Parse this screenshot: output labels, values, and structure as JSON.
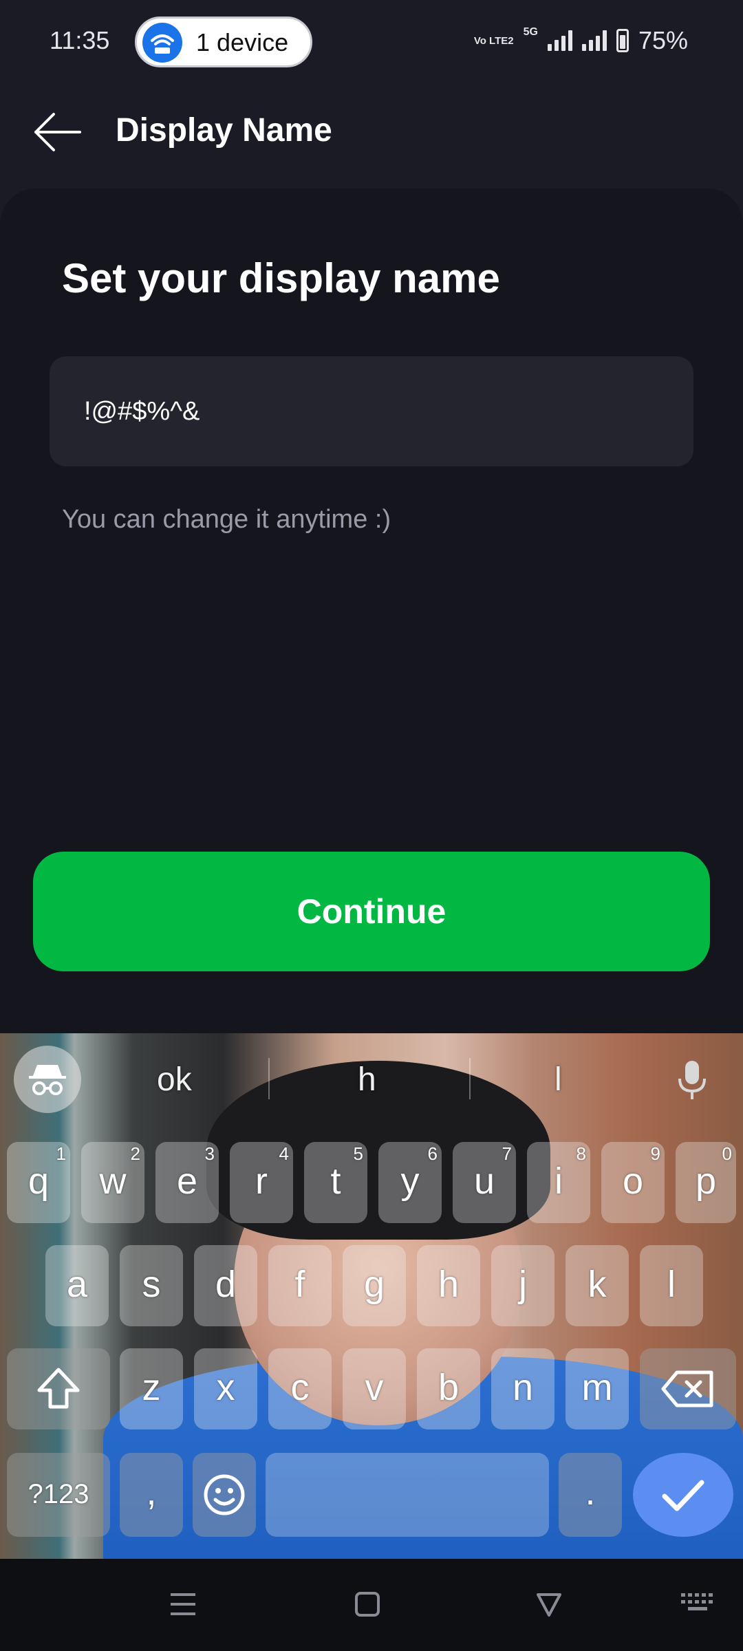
{
  "status_bar": {
    "time": "11:35",
    "device_pill": "1 device",
    "network_badge": "Vo LTE2",
    "network_type": "5G",
    "battery_percent": "75%"
  },
  "header": {
    "title": "Display Name",
    "back_icon": "arrow-left-icon"
  },
  "main": {
    "heading": "Set your display name",
    "name_input_value": "!@#$%^&",
    "hint": "You can change it anytime :)",
    "continue_label": "Continue",
    "accent_color": "#02b843"
  },
  "keyboard": {
    "suggestions": [
      "ok",
      "h",
      "l"
    ],
    "row1": [
      {
        "k": "q",
        "s": "1"
      },
      {
        "k": "w",
        "s": "2"
      },
      {
        "k": "e",
        "s": "3"
      },
      {
        "k": "r",
        "s": "4"
      },
      {
        "k": "t",
        "s": "5"
      },
      {
        "k": "y",
        "s": "6"
      },
      {
        "k": "u",
        "s": "7"
      },
      {
        "k": "i",
        "s": "8"
      },
      {
        "k": "o",
        "s": "9"
      },
      {
        "k": "p",
        "s": "0"
      }
    ],
    "row2": [
      "a",
      "s",
      "d",
      "f",
      "g",
      "h",
      "j",
      "k",
      "l"
    ],
    "row3": [
      "z",
      "x",
      "c",
      "v",
      "b",
      "n",
      "m"
    ],
    "symbols_label": "?123",
    "comma_label": ",",
    "period_label": "."
  }
}
